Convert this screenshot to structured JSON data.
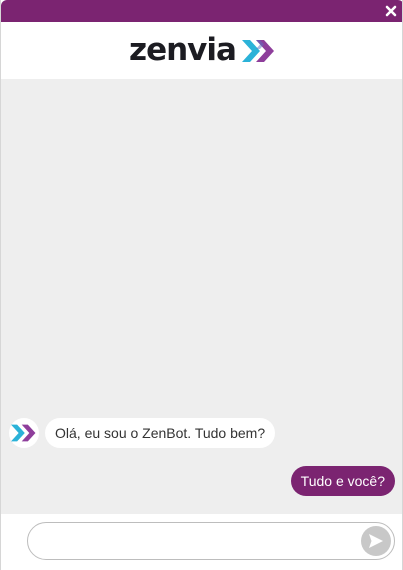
{
  "window": {
    "close_icon": "close-icon"
  },
  "header": {
    "logo_text": "zenvia",
    "logo_icon": "double-chevron-icon"
  },
  "conversation": {
    "messages": [
      {
        "sender": "bot",
        "text": "Olá, eu sou o ZenBot. Tudo bem?"
      },
      {
        "sender": "user",
        "text": "Tudo e você?"
      }
    ]
  },
  "composer": {
    "value": "",
    "placeholder": "",
    "send_icon": "send-arrow-icon"
  },
  "colors": {
    "brand": "#7b2471",
    "chat_background": "#eeeeee",
    "chevron_blue": "#2bb2d8",
    "chevron_purple": "#8e3e9b"
  }
}
